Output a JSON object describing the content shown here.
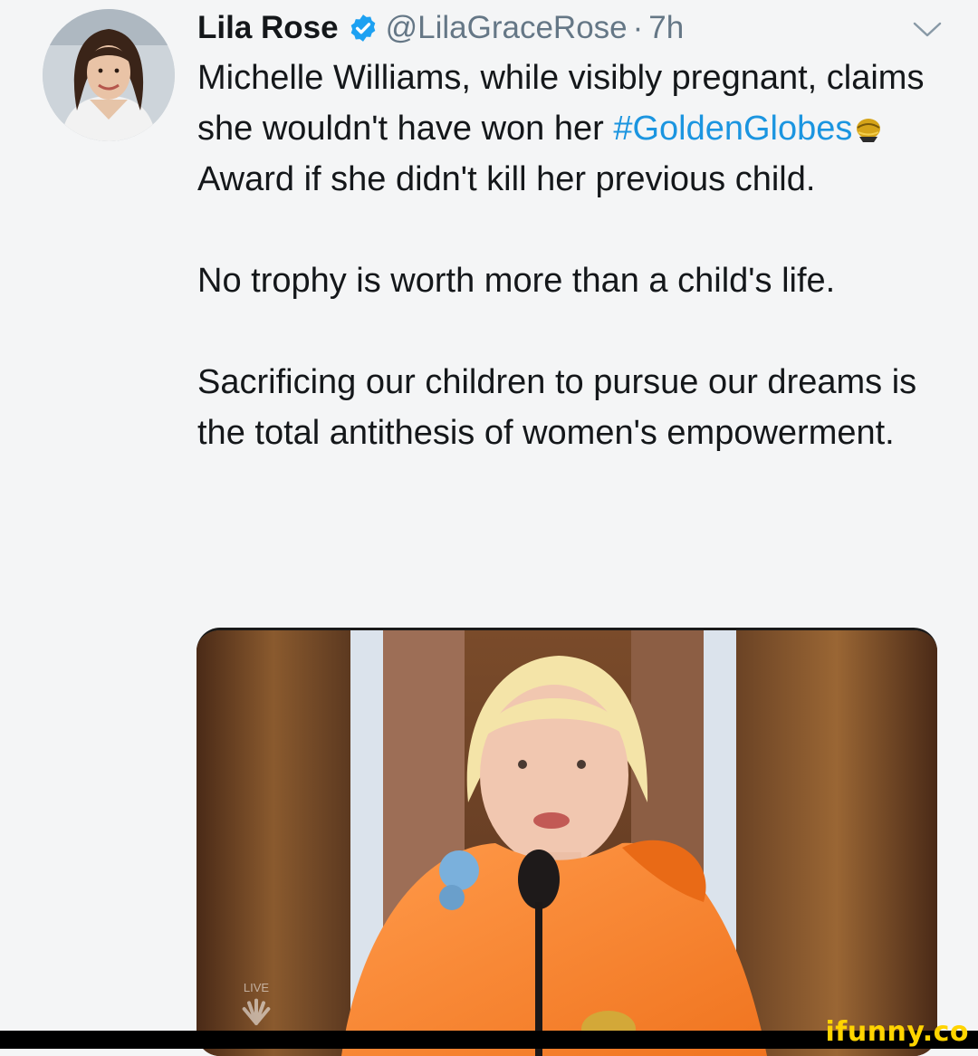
{
  "tweet": {
    "author_name": "Lila Rose",
    "handle": "@LilaGraceRose",
    "separator": "·",
    "time": "7h",
    "text": {
      "p1_a": "Michelle Williams, while visibly pregnant, claims she wouldn't have won her ",
      "hashtag": "#GoldenGlobes",
      "p1_b": " Award if she didn't kill her previous child.",
      "p2": "No trophy is worth more than a child's life.",
      "p3": "Sacrificing our children to pursue our dreams is the total antithesis of women's empowerment."
    }
  },
  "media": {
    "watermark_line1": "LIVE"
  },
  "site_watermark": "ifunny.co",
  "colors": {
    "accent": "#1b95e0",
    "text": "#14171a",
    "muted": "#657786",
    "watermark": "#ffd400"
  },
  "icons": [
    "verified-badge-icon",
    "chevron-down-icon",
    "golden-globe-emoji-icon",
    "nbc-peacock-icon"
  ]
}
